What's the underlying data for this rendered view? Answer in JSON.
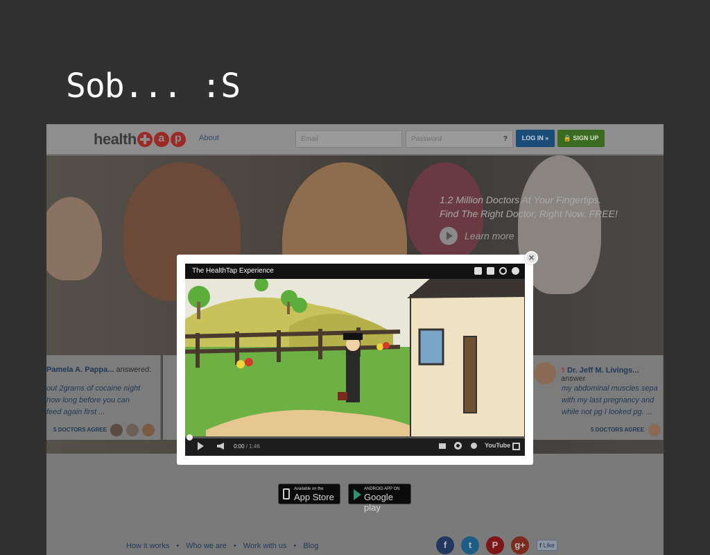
{
  "slide": {
    "title": "Sob... :S"
  },
  "header": {
    "logo_text": "health",
    "logo_letters": [
      "a",
      "p"
    ],
    "about_label": "About",
    "email_placeholder": "Email",
    "password_placeholder": "Password",
    "password_help": "?",
    "login_label": "LOG IN »",
    "signup_label": "SIGN UP"
  },
  "hero": {
    "tagline_line1": "1.2 Million Doctors At Your Fingertips.",
    "tagline_line2": "Find The Right Doctor, Right Now. FREE!",
    "learn_more": "Learn more"
  },
  "cards": [
    {
      "doctor": "Pamela A. Pappa...",
      "answered": "answered:",
      "question_lines": [
        "out 2grams of cocaine night",
        "how long before you can",
        "feed again first ..."
      ],
      "agree": "5 DOCTORS AGREE"
    },
    {
      "doctor": "Dr. Jeff M. Livings...",
      "answered": "answer",
      "question_lines": [
        "my abdominal muscles sepa",
        "with my last pregnancy and",
        "while not pg I looked pg. ..."
      ],
      "agree": "5 DOCTORS AGREE"
    }
  ],
  "video": {
    "title": "The HealthTap Experience",
    "time_current": "0:00",
    "time_total": " / 1:46",
    "progress": 0,
    "close": "×",
    "youtube": "YouTube"
  },
  "stores": {
    "apple_small": "Available on the",
    "apple_big": "App Store",
    "google_small": "ANDROID APP ON",
    "google_big": "Google play"
  },
  "footer": {
    "links": [
      "How it works",
      "Who we are",
      "Work with us",
      "Blog"
    ],
    "separator": "•",
    "social": [
      "f",
      "t",
      "P",
      "g+"
    ],
    "like_label": "Like"
  }
}
